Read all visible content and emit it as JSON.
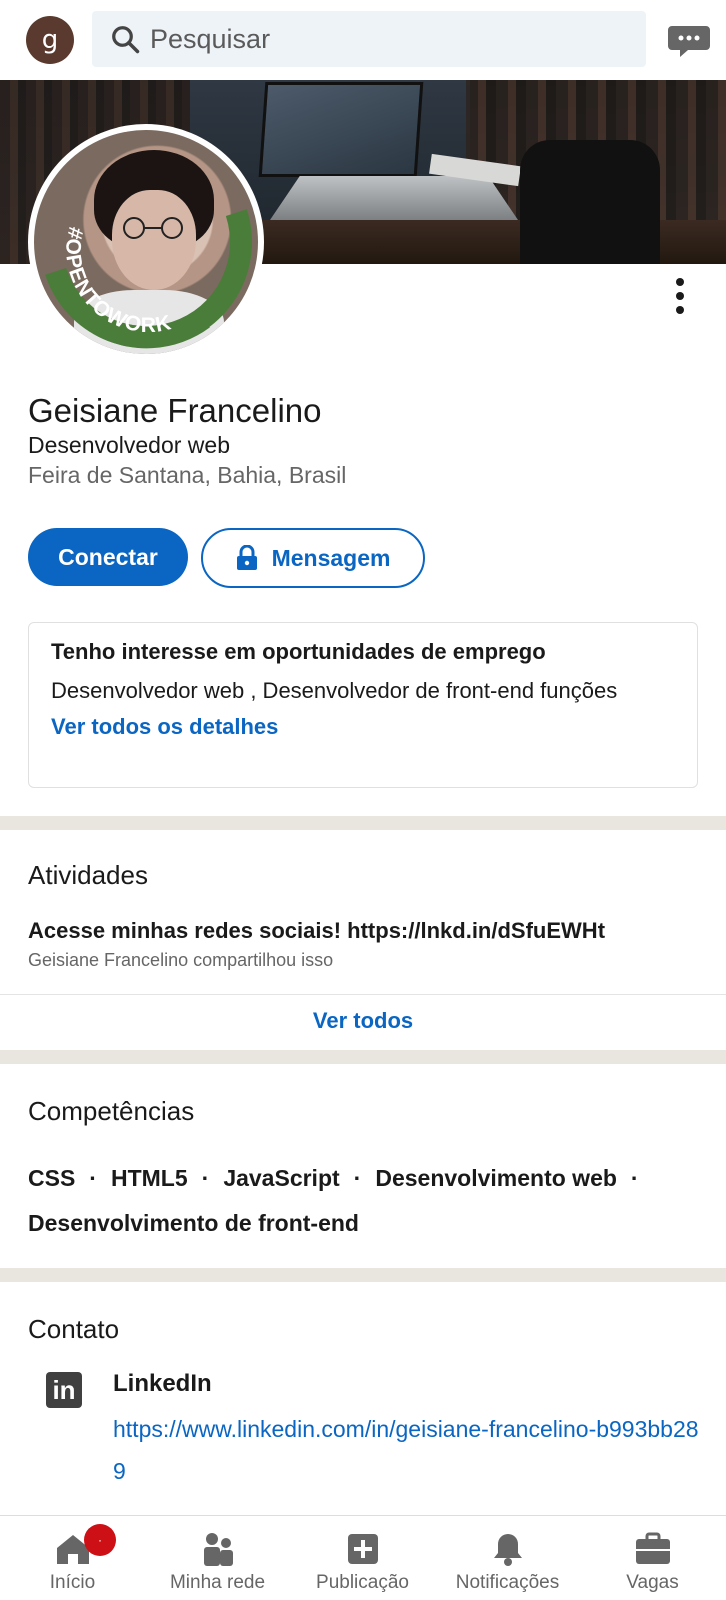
{
  "topbar": {
    "avatar_letter": "g",
    "search_placeholder": "Pesquisar"
  },
  "profile": {
    "badge_text": "#OPENTOWORK",
    "name": "Geisiane Francelino",
    "headline": "Desenvolvedor web",
    "location": "Feira de Santana, Bahia, Brasil",
    "connect_label": "Conectar",
    "message_label": "Mensagem"
  },
  "open_to_work": {
    "title": "Tenho interesse em oportunidades de emprego",
    "roles": "Desenvolvedor web , Desenvolvedor de front-end funções",
    "link": "Ver todos os detalhes"
  },
  "activity": {
    "section_title": "Atividades",
    "post_title": "Acesse minhas redes sociais! https://lnkd.in/dSfuEWHt",
    "post_sub": "Geisiane Francelino compartilhou isso",
    "see_all": "Ver todos"
  },
  "skills": {
    "section_title": "Competências",
    "items": [
      "CSS",
      "HTML5",
      "JavaScript",
      "Desenvolvimento web",
      "Desenvolvimento de front-end"
    ],
    "separator": "·"
  },
  "contact": {
    "section_title": "Contato",
    "icon_text": "in",
    "network": "LinkedIn",
    "url": "https://www.linkedin.com/in/geisiane-francelino-b993bb289"
  },
  "bottom_nav": {
    "items": [
      {
        "label": "Início",
        "icon": "home-icon"
      },
      {
        "label": "Minha rede",
        "icon": "network-icon"
      },
      {
        "label": "Publicação",
        "icon": "post-icon"
      },
      {
        "label": "Notificações",
        "icon": "bell-icon"
      },
      {
        "label": "Vagas",
        "icon": "briefcase-icon"
      }
    ],
    "home_badge": "·"
  },
  "colors": {
    "brand_blue": "#0a66c2",
    "open_to_work_green": "#4b7d3a",
    "notification_red": "#cc1016"
  }
}
